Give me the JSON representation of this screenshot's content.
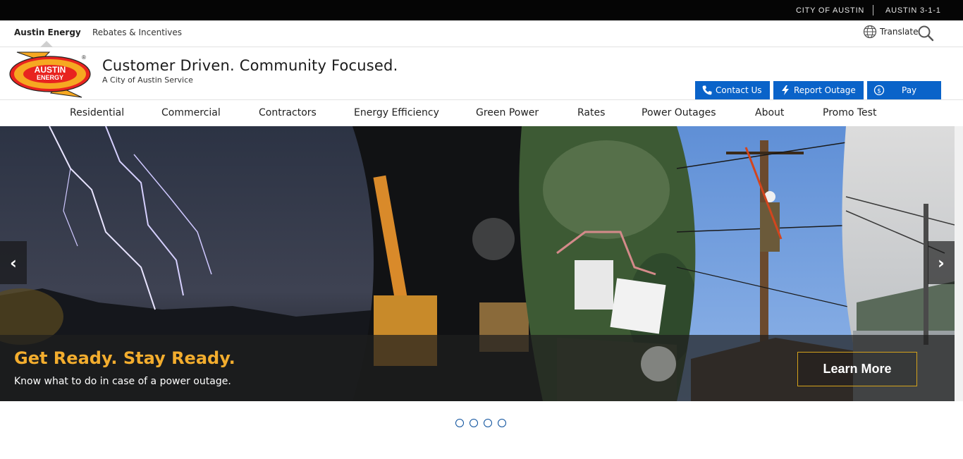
{
  "utility_bar": {
    "city_link": "CITY OF AUSTIN",
    "phone_link": "AUSTIN 3-1-1"
  },
  "site_bar": {
    "items": [
      {
        "label": "Austin Energy",
        "active": true
      },
      {
        "label": "Rebates & Incentives",
        "active": false
      }
    ],
    "translate_label": "Translate"
  },
  "header": {
    "logo_text": "AUSTIN ENERGY",
    "title": "Customer Driven. Community Focused.",
    "subtitle": "A City of Austin Service",
    "buttons": {
      "contact": "Contact Us",
      "outage": "Report Outage",
      "pay": "Pay"
    },
    "accent_color": "#0a63c9"
  },
  "main_nav": {
    "items": [
      "Residential",
      "Commercial",
      "Contractors",
      "Energy Efficiency",
      "Green Power",
      "Rates",
      "Power Outages",
      "About",
      "Promo Test"
    ]
  },
  "hero": {
    "headline": "Get Ready. Stay Ready.",
    "subline": "Know what to do in case of a power outage.",
    "cta": "Learn More",
    "headline_color": "#f3ad2e",
    "prev_icon": "‹",
    "next_icon": "›"
  },
  "carousel": {
    "slide_count": 4
  }
}
